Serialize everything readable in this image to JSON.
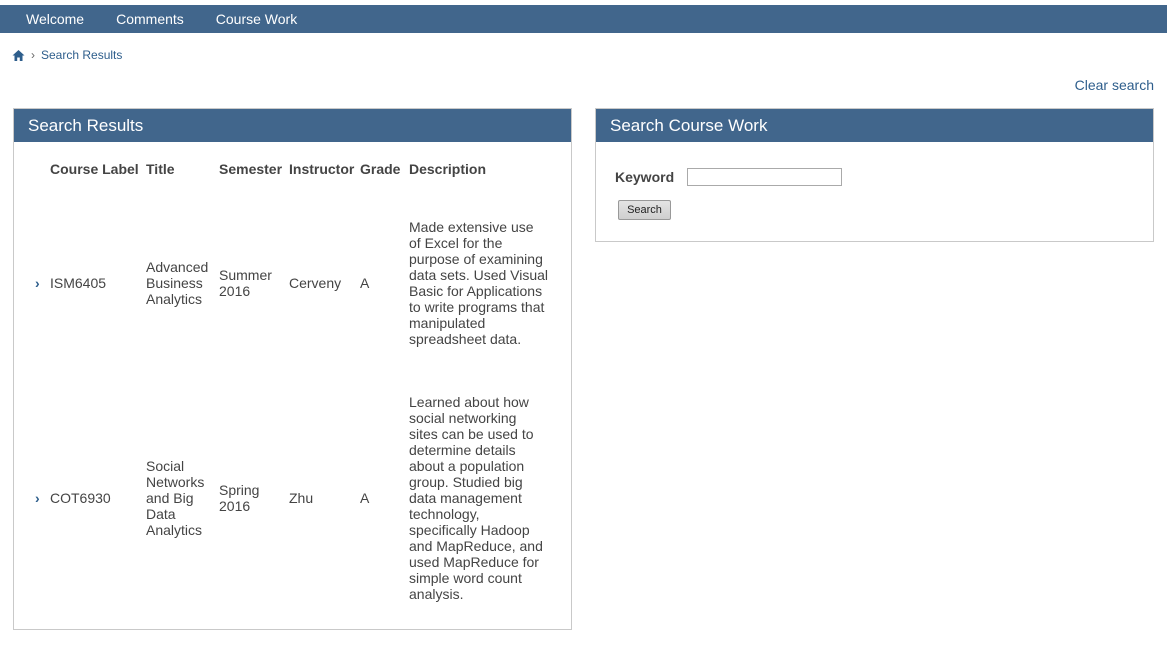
{
  "nav": {
    "items": [
      "Welcome",
      "Comments",
      "Course Work"
    ]
  },
  "breadcrumb": {
    "home_icon": "home-icon",
    "separator": "›",
    "current": "Search Results"
  },
  "clear_search": "Clear search",
  "results": {
    "title": "Search Results",
    "columns": [
      "Course Label",
      "Title",
      "Semester",
      "Instructor",
      "Grade",
      "Description"
    ],
    "rows": [
      {
        "label": "ISM6405",
        "title": "Advanced Business Analytics",
        "semester": "Summer 2016",
        "instructor": "Cerveny",
        "grade": "A",
        "description": "Made extensive use of Excel for the purpose of examining data sets.  Used Visual Basic for Applications to write programs that manipulated spreadsheet data."
      },
      {
        "label": "COT6930",
        "title": "Social Networks and Big Data Analytics",
        "semester": "Spring 2016",
        "instructor": "Zhu",
        "grade": "A",
        "description": "Learned about how social networking sites can be used to determine details about a population group.  Studied big data management technology, specifically Hadoop and MapReduce, and used MapReduce for simple word count analysis."
      }
    ]
  },
  "search": {
    "title": "Search Course Work",
    "keyword_label": "Keyword",
    "keyword_value": "",
    "button_label": "Search"
  },
  "colors": {
    "header_bg": "#41668c",
    "link": "#2e5e8c"
  }
}
